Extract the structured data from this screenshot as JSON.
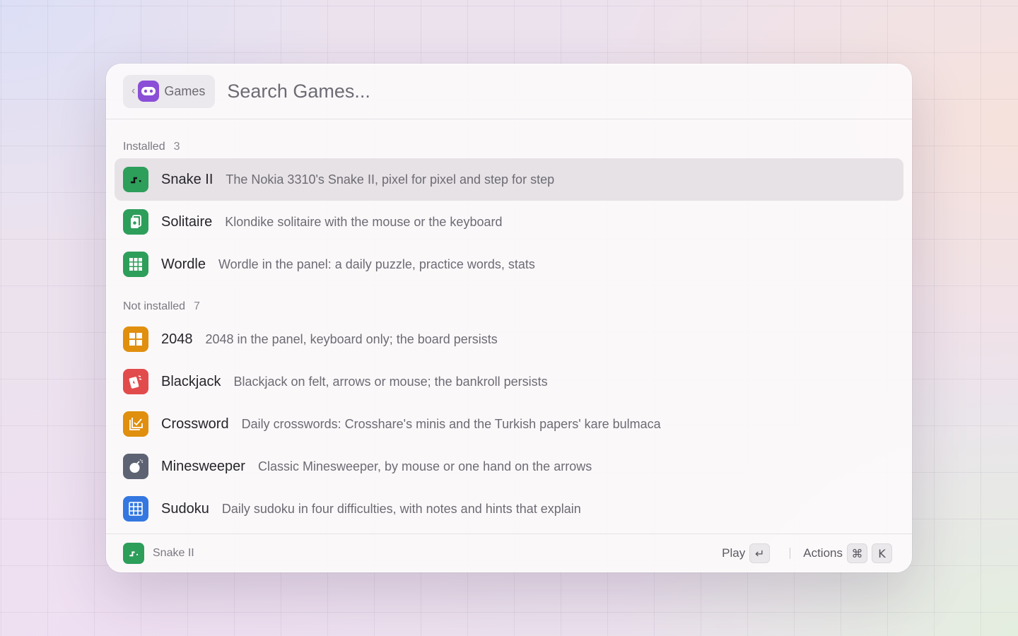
{
  "header": {
    "back_label": "Games",
    "search_placeholder": "Search Games..."
  },
  "sections": [
    {
      "label": "Installed",
      "count": "3",
      "items": [
        {
          "title": "Snake II",
          "subtitle": "The Nokia 3310's Snake II, pixel for pixel and step for step",
          "icon": "snake-icon",
          "color": "#2e9e5b",
          "selected": true
        },
        {
          "title": "Solitaire",
          "subtitle": "Klondike solitaire with the mouse or the keyboard",
          "icon": "cards-icon",
          "color": "#2e9e5b"
        },
        {
          "title": "Wordle",
          "subtitle": "Wordle in the panel: a daily puzzle, practice words, stats",
          "icon": "grid-icon",
          "color": "#2e9e5b"
        }
      ]
    },
    {
      "label": "Not installed",
      "count": "7",
      "items": [
        {
          "title": "2048",
          "subtitle": "2048 in the panel, keyboard only; the board persists",
          "icon": "tiles-icon",
          "color": "#e08f0e"
        },
        {
          "title": "Blackjack",
          "subtitle": "Blackjack on felt, arrows or mouse; the bankroll persists",
          "icon": "playing-cards-icon",
          "color": "#e24b4b"
        },
        {
          "title": "Crossword",
          "subtitle": "Daily crosswords: Crosshare's minis and the Turkish papers' kare bulmaca",
          "icon": "crossword-icon",
          "color": "#e08f0e"
        },
        {
          "title": "Minesweeper",
          "subtitle": "Classic Minesweeper, by mouse or one hand on the arrows",
          "icon": "bomb-icon",
          "color": "#5d6372"
        },
        {
          "title": "Sudoku",
          "subtitle": "Daily sudoku in four difficulties, with notes and hints that explain",
          "icon": "sudoku-grid-icon",
          "color": "#3477e0"
        }
      ]
    }
  ],
  "footer": {
    "selected_title": "Snake II",
    "primary_action": "Play",
    "primary_key": "↵",
    "actions_label": "Actions",
    "actions_keys": [
      "⌘",
      "K"
    ]
  },
  "colors": {
    "accent_purple": "#8a4fd6",
    "green": "#2e9e5b",
    "orange": "#e08f0e",
    "red": "#e24b4b",
    "slate": "#5d6372",
    "blue": "#3477e0"
  }
}
